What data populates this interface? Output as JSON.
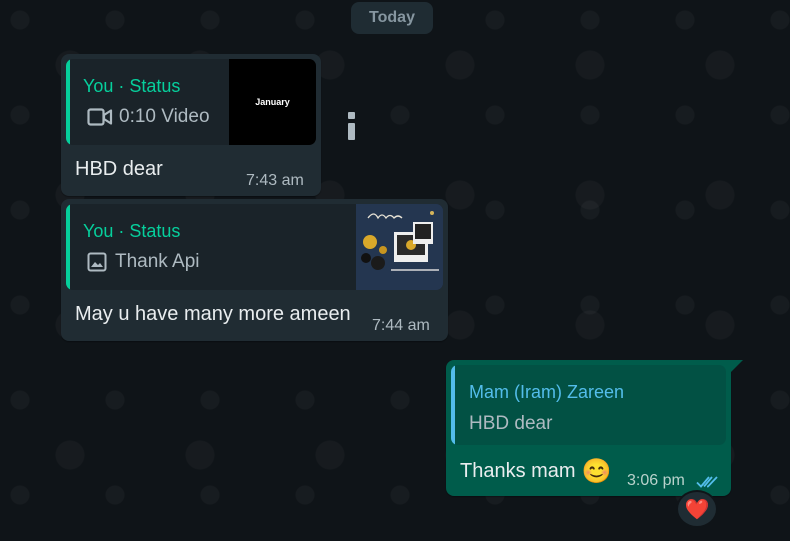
{
  "date_separator": "Today",
  "messages": [
    {
      "quote": {
        "author": "You · Status",
        "media_label": "0:10 Video",
        "thumb_text": "January"
      },
      "text": "HBD dear",
      "time": "7:43 am"
    },
    {
      "quote": {
        "author": "You · Status",
        "media_label": "Thank Api"
      },
      "text": "May u have many more ameen",
      "time": "7:44 am"
    },
    {
      "quote": {
        "author": "Mam (Iram) Zareen",
        "quoted_text": "HBD dear"
      },
      "text": "Thanks mam",
      "emoji": "😊",
      "time": "3:06 pm",
      "reaction": "❤️"
    }
  ],
  "colors": {
    "incoming_bubble": "#202c33",
    "outgoing_bubble": "#005c4b",
    "status_accent": "#06cf9c",
    "reply_accent": "#53bdeb",
    "read_ticks": "#53bdeb",
    "reaction_heart": "#e0245e"
  },
  "icons": [
    "video-icon",
    "image-icon",
    "message-info-icon",
    "read-ticks-icon",
    "heart-reaction-icon"
  ]
}
